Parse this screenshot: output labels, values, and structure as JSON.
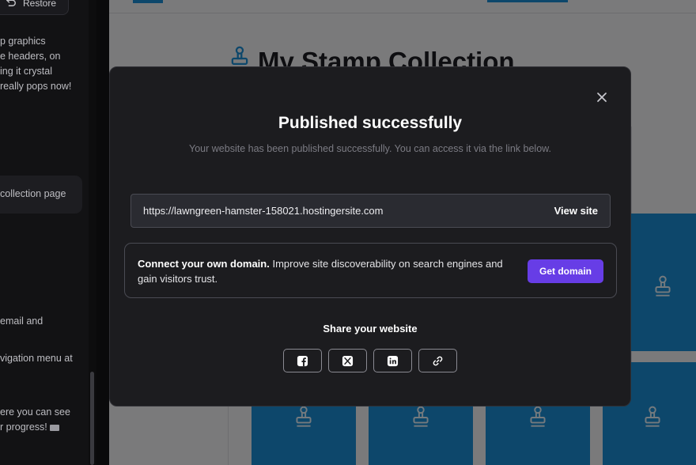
{
  "chat": {
    "restore_label": "Restore",
    "message_1": [
      "p graphics",
      "e headers, on",
      "ing it crystal",
      "really pops now!"
    ],
    "bubble_text": "collection page",
    "message_2": "email and",
    "message_3": "vigation menu at",
    "message_4": [
      "ere you can see",
      "r progress!"
    ]
  },
  "preview": {
    "site_title": "My Stamp Collection"
  },
  "modal": {
    "title": "Published successfully",
    "subtitle": "Your website has been published successfully. You can access it via the link below.",
    "url": "https://lawngreen-hamster-158021.hostingersite.com",
    "view_site_label": "View site",
    "domain_bold": "Connect your own domain.",
    "domain_text": " Improve site discoverability on search engines and gain visitors trust.",
    "get_domain_label": "Get domain",
    "share_label": "Share your website",
    "share_buttons": [
      "facebook-icon",
      "x-icon",
      "linkedin-icon",
      "link-icon"
    ]
  },
  "colors": {
    "accent_purple": "#673de6",
    "site_blue": "#1a8fd6",
    "modal_bg": "#1c1c1f"
  }
}
